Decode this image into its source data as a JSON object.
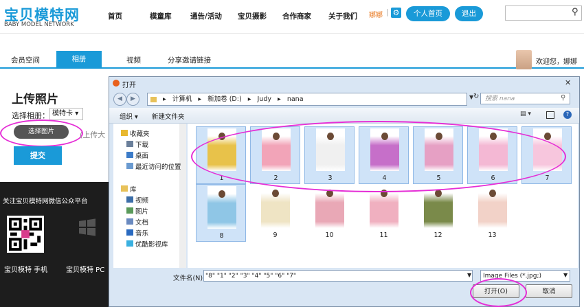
{
  "header": {
    "logo_cn": "宝贝模特网",
    "logo_en": "BABY MODEL NETWORK",
    "nav": [
      "首页",
      "模童库",
      "通告/活动",
      "宝贝摄影",
      "合作商家",
      "关于我们"
    ],
    "user_name": "娜娜",
    "separator": "|",
    "home_button": "个人首页",
    "logout_button": "退出",
    "search_placeholder": ""
  },
  "tabs": {
    "items": [
      "会员空间",
      "相册",
      "视频",
      "分享邀请链接"
    ],
    "active": "相册",
    "welcome": "欢迎您，娜娜"
  },
  "upload": {
    "title": "上传照片",
    "album_label": "选择相册：",
    "album_value": "模特卡",
    "choose_button": "选择图片",
    "hint_partial": "(上传大",
    "submit_button": "提交"
  },
  "footer": {
    "wechat_text": "关注宝贝模特网微信公众平台",
    "mobile_label": "宝贝模特 手机",
    "pc_label": "宝贝模特 PC"
  },
  "dialog": {
    "title": "打开",
    "close": "✕",
    "address": [
      "计算机",
      "新加卷 (D:)",
      "Judy",
      "nana"
    ],
    "search_placeholder": "搜索 nana",
    "organize": "组织 ▾",
    "new_folder": "新建文件夹",
    "nav_items": [
      {
        "label": "收藏夹",
        "icon": "star-icon"
      },
      {
        "label": "下载",
        "icon": "download-folder-icon"
      },
      {
        "label": "桌面",
        "icon": "desktop-icon"
      },
      {
        "label": "最近访问的位置",
        "icon": "recent-icon"
      },
      {
        "label": "库",
        "icon": "library-icon"
      },
      {
        "label": "视频",
        "icon": "video-icon"
      },
      {
        "label": "图片",
        "icon": "pictures-icon"
      },
      {
        "label": "文档",
        "icon": "documents-icon"
      },
      {
        "label": "音乐",
        "icon": "music-icon"
      },
      {
        "label": "优酷影视库",
        "icon": "youku-icon"
      }
    ],
    "files": [
      {
        "name": "1",
        "selected": true,
        "color": "#e8c24a"
      },
      {
        "name": "2",
        "selected": true,
        "color": "#f2a4b8"
      },
      {
        "name": "3",
        "selected": true,
        "color": "#f0f0f0"
      },
      {
        "name": "4",
        "selected": true,
        "color": "#c66fc9"
      },
      {
        "name": "5",
        "selected": true,
        "color": "#e6a0c4"
      },
      {
        "name": "6",
        "selected": true,
        "color": "#f4b8d4"
      },
      {
        "name": "7",
        "selected": true,
        "color": "#f7c6dd"
      },
      {
        "name": "8",
        "selected": true,
        "color": "#8fc6e6"
      },
      {
        "name": "9",
        "selected": false,
        "color": "#efe4c4"
      },
      {
        "name": "10",
        "selected": false,
        "color": "#e9a8b6"
      },
      {
        "name": "11",
        "selected": false,
        "color": "#f0b0c0"
      },
      {
        "name": "12",
        "selected": false,
        "color": "#7a8a4a"
      },
      {
        "name": "13",
        "selected": false,
        "color": "#f2d2c8"
      }
    ],
    "filename_label": "文件名(N):",
    "filename_value": "\"8\" \"1\" \"2\" \"3\" \"4\" \"5\" \"6\" \"7\"",
    "filetype": "Image Files (*.jpg;)",
    "open_button": "打开(O)",
    "cancel_button": "取消"
  }
}
